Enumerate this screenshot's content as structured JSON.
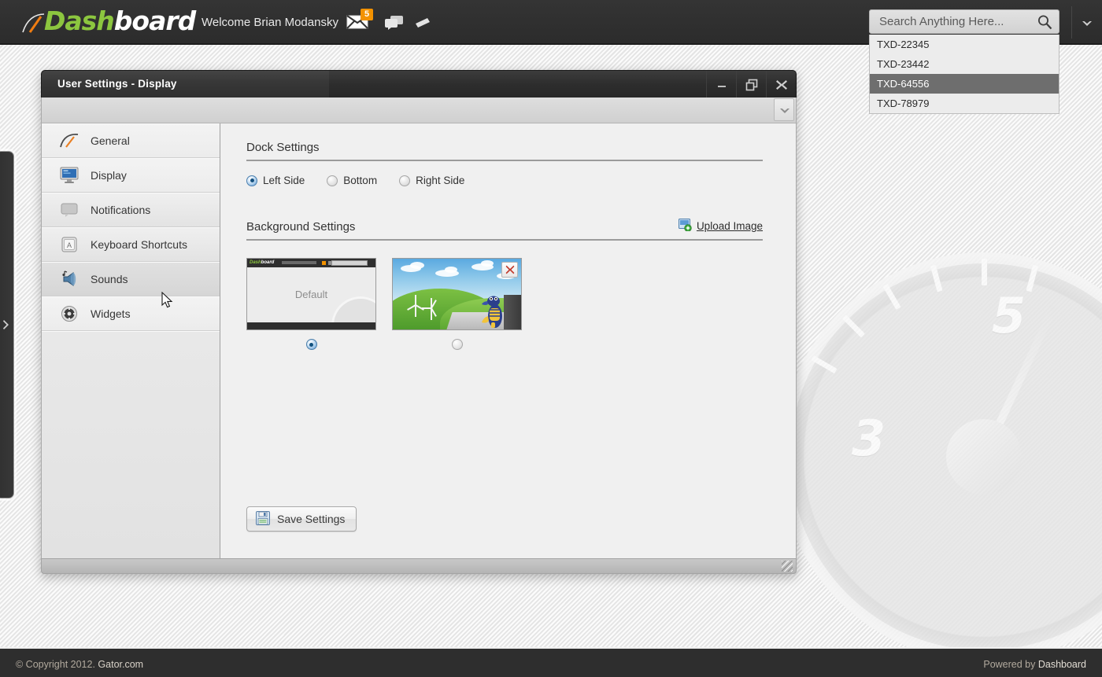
{
  "header": {
    "logo_accent": "Dash",
    "logo_main": "board",
    "welcome": "Welcome Brian Modansky",
    "mail_icon": "envelope-icon",
    "mail_badge": "5",
    "chat_icon": "chat-bubbles-icon",
    "tag_icon": "tag-icon",
    "chevron_icon": "chevron-down-icon",
    "brand_green": "#8cc63f",
    "badge_orange": "#f39200"
  },
  "search": {
    "placeholder": "Search Anything Here...",
    "value": "",
    "icon": "search-icon",
    "results": [
      {
        "label": "TXD-22345",
        "selected": false
      },
      {
        "label": "TXD-23442",
        "selected": false
      },
      {
        "label": "TXD-64556",
        "selected": true
      },
      {
        "label": "TXD-78979",
        "selected": false
      }
    ],
    "highlight_color": "#6e6e6e"
  },
  "dock": {
    "expand_icon": "chevron-right-icon"
  },
  "window": {
    "title": "User Settings - Display",
    "minimize_icon": "minimize-icon",
    "restore_icon": "restore-icon",
    "close_icon": "close-icon",
    "toolbar_dropdown_icon": "chevron-down-icon",
    "resize_grip": "resize-grip"
  },
  "sidebar": {
    "items": [
      {
        "label": "General",
        "icon": "gauge-icon",
        "state": "light"
      },
      {
        "label": "Display",
        "icon": "monitor-icon",
        "state": "light"
      },
      {
        "label": "Notifications",
        "icon": "speech-icon",
        "state": "normal"
      },
      {
        "label": "Keyboard Shortcuts",
        "icon": "keycap-icon",
        "state": "normal"
      },
      {
        "label": "Sounds",
        "icon": "speaker-icon",
        "state": "selected"
      },
      {
        "label": "Widgets",
        "icon": "widgets-icon",
        "state": "light"
      }
    ]
  },
  "content": {
    "dock_settings": {
      "title": "Dock Settings",
      "options": [
        {
          "label": "Left Side",
          "selected": true
        },
        {
          "label": "Bottom",
          "selected": false
        },
        {
          "label": "Right Side",
          "selected": false
        }
      ]
    },
    "background_settings": {
      "title": "Background Settings",
      "upload_label": "Upload Image",
      "upload_icon": "upload-image-icon",
      "thumbnails": [
        {
          "name": "default",
          "label": "Default",
          "selected": true,
          "deletable": false
        },
        {
          "name": "nature",
          "label": "",
          "selected": false,
          "deletable": true,
          "delete_icon": "delete-x-icon"
        }
      ]
    },
    "save_button": {
      "label": "Save Settings",
      "icon": "floppy-save-icon"
    }
  },
  "footer": {
    "copyright_prefix": "© Copyright 2012. ",
    "copyright_brand": "Gator.com",
    "powered_prefix": "Powered by ",
    "powered_brand": "Dashboard"
  }
}
